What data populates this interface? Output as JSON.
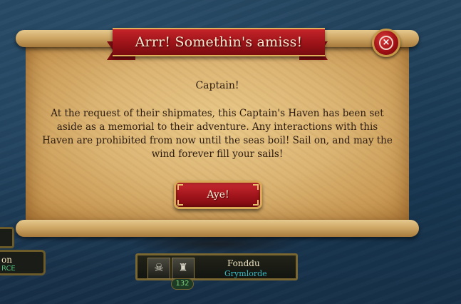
{
  "dialog": {
    "title": "Arrr! Somethin's amiss!",
    "heading": "Captain!",
    "message": "At the request of their shipmates, this Captain's Haven has been set aside as a memorial to their adventure. Any interactions with this Haven are prohibited from now until the seas boil! Sail on, and may the wind forever fill your sails!",
    "confirm_label": "Aye!",
    "close_icon": "close-icon",
    "close_glyph": "×"
  },
  "background_hud": {
    "left_plate": {
      "name_fragment": "on",
      "tag_fragment": "RCE"
    },
    "player": {
      "name": "Fonddu",
      "guild": "Grymlorde",
      "level": "132",
      "portrait_icons": [
        "skull-icon",
        "pirate-icon"
      ]
    }
  },
  "colors": {
    "banner_red": "#9b1318",
    "parchment": "#dcb574",
    "gold_trim": "#d8aa55",
    "guild_teal": "#36b9c2",
    "level_green": "#7bd37a"
  }
}
